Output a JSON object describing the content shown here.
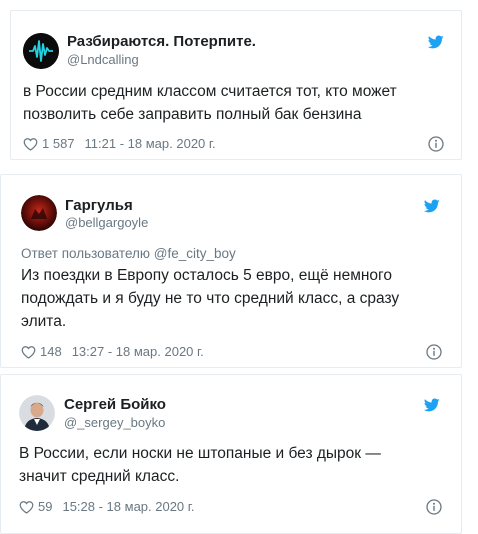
{
  "tweets": [
    {
      "name": "Разбираются. Потерпите.",
      "handle": "@Lndcalling",
      "reply_to": "",
      "text": "в России средним классом считается тот, кто может позволить себе заправить полный бак бензина",
      "likes": "1 587",
      "time": "11:21 - 18 мар. 2020 г."
    },
    {
      "name": "Гаргулья",
      "handle": "@bellgargoyle",
      "reply_to": "Ответ пользователю @fe_city_boy",
      "text": "Из поездки в Европу осталось 5 евро, ещё немного подождать и я буду не то что средний класс, а сразу элита.",
      "likes": "148",
      "time": "13:27 - 18 мар. 2020 г."
    },
    {
      "name": "Сергей Бойко",
      "handle": "@_sergey_boyko",
      "reply_to": "",
      "text": "В России, если носки не штопаные и без дырок — значит средний класс.",
      "likes": "59",
      "time": "15:28 - 18 мар. 2020 г."
    }
  ],
  "colors": {
    "twitter_blue": "#1da1f2",
    "muted": "#697882",
    "text": "#1c2022",
    "border": "#e6ecf0"
  },
  "icons": [
    "twitter-bird-icon",
    "heart-icon",
    "info-icon"
  ]
}
